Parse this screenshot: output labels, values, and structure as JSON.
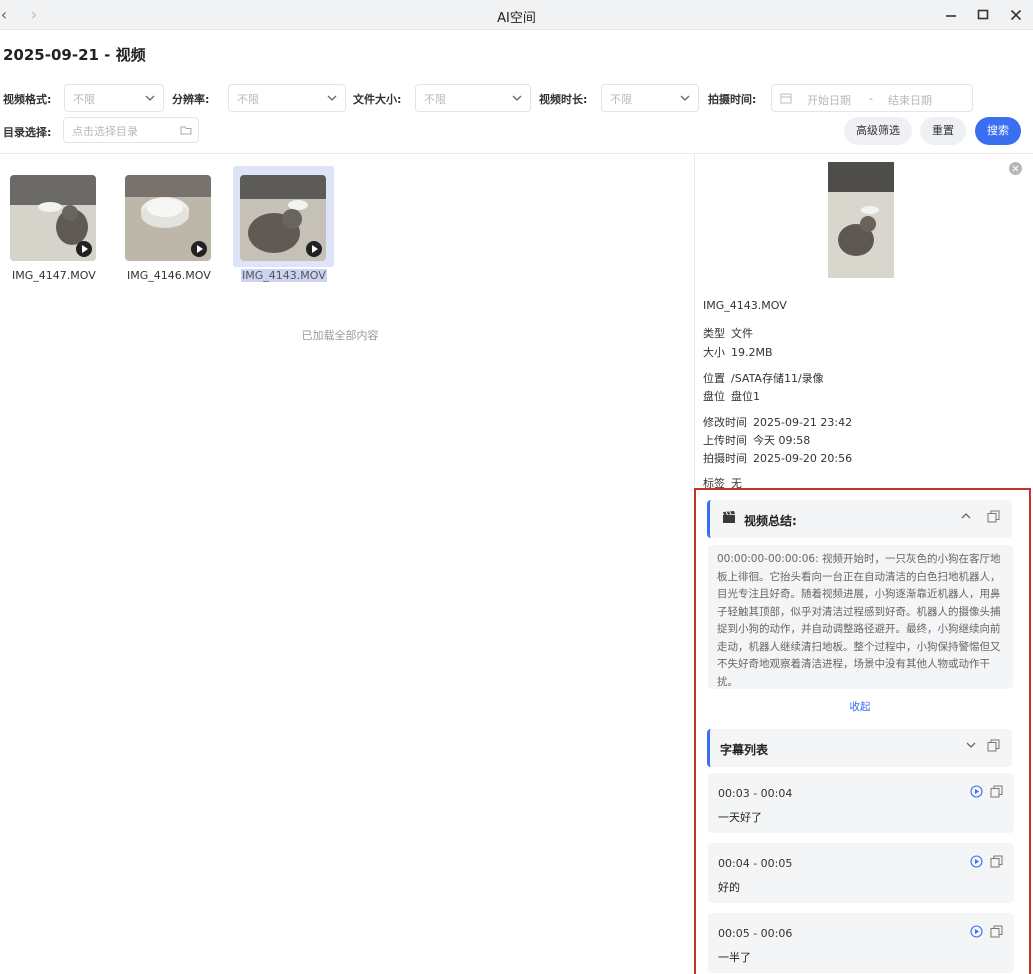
{
  "window": {
    "title": "AI空间",
    "back_glyph": "‹",
    "forward_glyph": "›"
  },
  "page_title": "2025-09-21 - 视频",
  "filters": {
    "format_label": "视频格式:",
    "format_value": "不限",
    "resolution_label": "分辨率:",
    "resolution_value": "不限",
    "size_label": "文件大小:",
    "size_value": "不限",
    "duration_label": "视频时长:",
    "duration_value": "不限",
    "date_label": "拍摄时间:",
    "date_start_placeholder": "开始日期",
    "date_sep": "-",
    "date_end_placeholder": "结束日期",
    "dir_label": "目录选择:",
    "dir_placeholder": "点击选择目录",
    "advanced_button": "高级筛选",
    "reset_button": "重置",
    "search_button": "搜索"
  },
  "files": [
    {
      "name": "IMG_4147.MOV"
    },
    {
      "name": "IMG_4146.MOV"
    },
    {
      "name": "IMG_4143.MOV",
      "selected": true
    }
  ],
  "loaded_all": "已加载全部内容",
  "detail": {
    "name": "IMG_4143.MOV",
    "type_key": "类型",
    "type_val": "文件",
    "size_key": "大小",
    "size_val": "19.2MB",
    "location_key": "位置",
    "location_val": "/SATA存储11/录像",
    "disk_key": "盘位",
    "disk_val": "盘位1",
    "modified_key": "修改时间",
    "modified_val": "2025-09-21 23:42",
    "uploaded_key": "上传时间",
    "uploaded_val": "今天 09:58",
    "shot_key": "拍摄时间",
    "shot_val": "2025-09-20 20:56",
    "tags_key": "标签",
    "tags_val": "无"
  },
  "summary": {
    "title": "视频总结:",
    "text": "00:00:00-00:00:06: 视频开始时，一只灰色的小狗在客厅地板上徘徊。它抬头看向一台正在自动清洁的白色扫地机器人，目光专注且好奇。随着视频进展，小狗逐渐靠近机器人，用鼻子轻触其顶部，似乎对清洁过程感到好奇。机器人的摄像头捕捉到小狗的动作，并自动调整路径避开。最终，小狗继续向前走动，机器人继续清扫地板。整个过程中，小狗保持警惕但又不失好奇地观察着清洁进程，场景中没有其他人物或动作干扰。",
    "collapse_label": "收起"
  },
  "subtitles": {
    "title": "字幕列表",
    "items": [
      {
        "time": "00:03 - 00:04",
        "text": "一天好了"
      },
      {
        "time": "00:04 - 00:05",
        "text": "好的"
      },
      {
        "time": "00:05 - 00:06",
        "text": "一半了"
      }
    ]
  },
  "colors": {
    "accent": "#3a6ff2",
    "highlight_border": "#c9302c"
  }
}
